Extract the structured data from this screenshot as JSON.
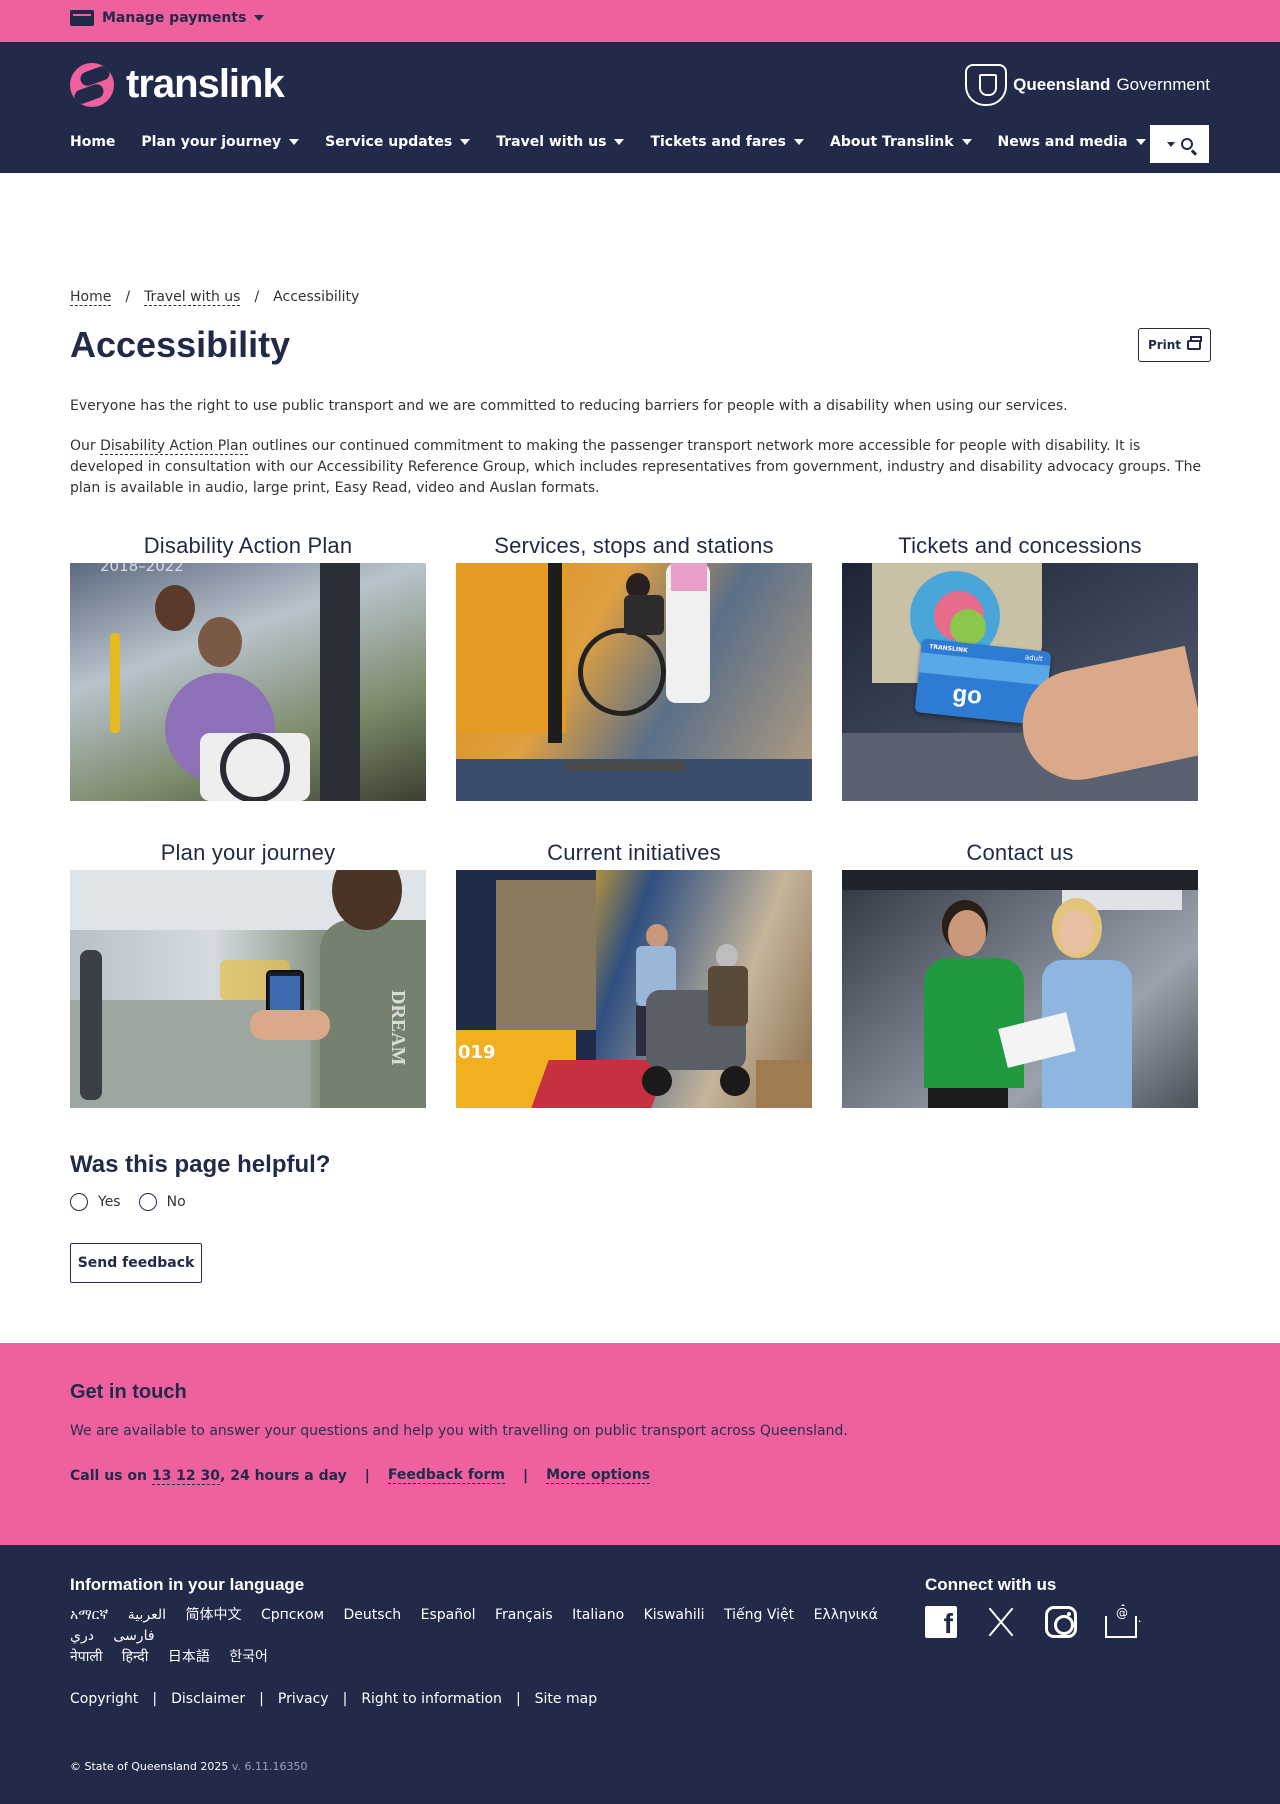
{
  "utility": {
    "manage_payments": "Manage payments"
  },
  "header": {
    "logo_text": "translink",
    "gov_bold": "Queensland",
    "gov_rest": " Government",
    "nav": [
      {
        "label": "Home"
      },
      {
        "label": "Plan your journey"
      },
      {
        "label": "Service updates"
      },
      {
        "label": "Travel with us"
      },
      {
        "label": "Tickets and fares"
      },
      {
        "label": "About Translink"
      },
      {
        "label": "News and media"
      }
    ]
  },
  "breadcrumb": {
    "home": "Home",
    "sep1": "/",
    "travel": "Travel with us",
    "sep2": "/",
    "current": "Accessibility"
  },
  "page": {
    "title": "Accessibility",
    "print_label": "Print",
    "intro1": "Everyone has the right to use public transport and we are committed to reducing barriers for people with a disability when using our services.",
    "intro2_pre": "Our ",
    "intro2_link": "Disability Action Plan",
    "intro2_post": " outlines our continued commitment to making the passenger transport network more accessible for people with disability. It is developed in consultation with our Accessibility Reference Group, which includes representatives from government, industry and disability advocacy groups. The plan is available in audio, large print, Easy Read, video and Auslan formats."
  },
  "tiles": [
    {
      "title": "Disability Action Plan",
      "overlay": "2018–2022"
    },
    {
      "title": "Services, stops and stations"
    },
    {
      "title": "Tickets and concessions",
      "card_label": "go",
      "card_top": "TRANSLINK",
      "card_adult": "adult"
    },
    {
      "title": "Plan your journey",
      "shirt_text": "DREAM"
    },
    {
      "title": "Current initiatives",
      "bus_num": "019"
    },
    {
      "title": "Contact us"
    }
  ],
  "feedback": {
    "question": "Was this page helpful?",
    "yes": "Yes",
    "no": "No",
    "send": "Send feedback"
  },
  "touch": {
    "title": "Get in touch",
    "desc": "We are available to answer your questions and help you with travelling on public transport across Queensland.",
    "call_pre": "Call us on ",
    "phone": "13 12 30",
    "call_post": ", 24 hours a day",
    "sep": "|",
    "feedback_form": "Feedback form",
    "more_options": "More options"
  },
  "footer": {
    "lang_title": "Information in your language",
    "languages": [
      "አማርኛ",
      "العربية",
      "简体中文",
      "Српском",
      "Deutsch",
      "Español",
      "Français",
      "Italiano",
      "Kiswahili",
      "Tiếng Việt",
      "Ελληνικά",
      "دري",
      "فارسی",
      "नेपाली",
      "हिन्दी",
      "日本語",
      "한국어"
    ],
    "connect_title": "Connect with us",
    "links": [
      "Copyright",
      "Disclaimer",
      "Privacy",
      "Right to information",
      "Site map"
    ],
    "link_sep": "|",
    "copyright": "© State of Queensland 2025",
    "version": " v. 6.11.16350"
  },
  "colors": {
    "pink": "#ee609e",
    "navy": "#222a4a"
  }
}
